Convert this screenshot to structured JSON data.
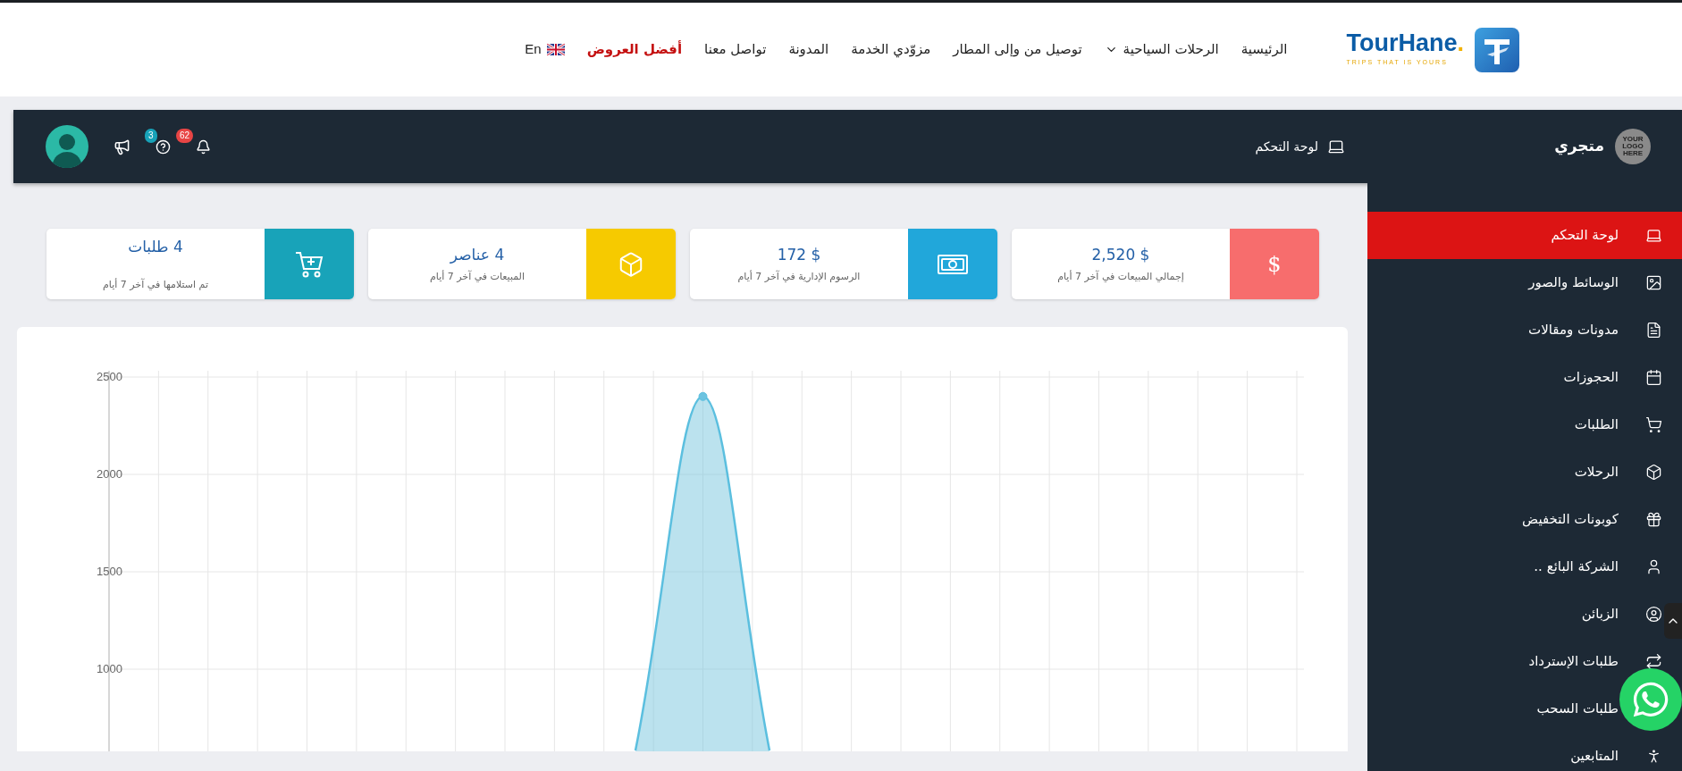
{
  "nav": {
    "logo": {
      "name": "TourHane",
      "dot": ".",
      "tagline": "TRIPS THAT IS YOURS"
    },
    "items": [
      {
        "label": "الرئيسية",
        "dropdown": false,
        "highlighted": false
      },
      {
        "label": "الرحلات السياحية",
        "dropdown": true,
        "highlighted": false
      },
      {
        "label": "توصيل من وإلى المطار",
        "dropdown": false,
        "highlighted": false
      },
      {
        "label": "مزوّدي الخدمة",
        "dropdown": false,
        "highlighted": false
      },
      {
        "label": "المدونة",
        "dropdown": false,
        "highlighted": false
      },
      {
        "label": "تواصل معنا",
        "dropdown": false,
        "highlighted": false
      },
      {
        "label": "أفضل العروض",
        "dropdown": false,
        "highlighted": true
      }
    ],
    "language": "En"
  },
  "header": {
    "store_logo": "YOUR LOGO HERE",
    "store_name": "متجري",
    "dashboard_link": "لوحة التحكم",
    "notifications": "62",
    "help": "3"
  },
  "sidebar": {
    "items": [
      {
        "label": "لوحة التحكم",
        "selected": true
      },
      {
        "label": "الوسائط والصور",
        "selected": false
      },
      {
        "label": "مدونات ومقالات",
        "selected": false
      },
      {
        "label": "الحجوزات",
        "selected": false
      },
      {
        "label": "الطلبات",
        "selected": false
      },
      {
        "label": "الرحلات",
        "selected": false
      },
      {
        "label": "كوبونات التخفيض",
        "selected": false
      },
      {
        "label": "الشركة البائع ..",
        "selected": false
      },
      {
        "label": "الزبائن",
        "selected": false
      },
      {
        "label": "طلبات الإسترداد",
        "selected": false
      },
      {
        "label": "طلبات السحب",
        "selected": false
      },
      {
        "label": "المتابعين",
        "selected": false
      }
    ]
  },
  "stats": [
    {
      "kind": "symbol",
      "symbol": "$",
      "value": "$ 2,520",
      "caption": "إجمالي المبيعات في آخر 7 أيام",
      "color": "#f76d6d"
    },
    {
      "kind": "money",
      "value": "$ 172",
      "caption": "الرسوم الإدارية في آخر 7 أيام",
      "color": "#21a7da"
    },
    {
      "kind": "box",
      "value": "4 عناصر",
      "caption": "المبيعات في آخر 7 أيام",
      "color": "#f6ca00"
    },
    {
      "kind": "cart",
      "value": "4 طلبات",
      "caption": "تم استلامها في آخر 7 أيام",
      "color": "#18a3b9"
    }
  ],
  "chart": {
    "y_labels": [
      "2500",
      "2000",
      "1500",
      "1000"
    ]
  }
}
